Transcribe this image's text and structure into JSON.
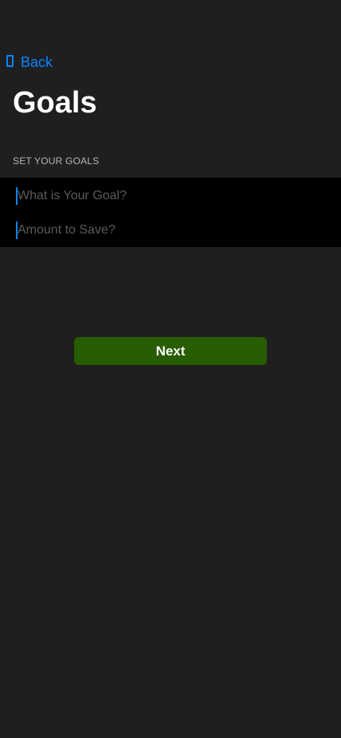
{
  "nav": {
    "back_label": "Back",
    "back_icon": "back-icon"
  },
  "header": {
    "title": "Goals"
  },
  "form": {
    "section_title": "SET YOUR GOALS",
    "goal_field": {
      "value": "",
      "placeholder": "What is Your Goal?"
    },
    "amount_field": {
      "value": "",
      "placeholder": "Amount to Save?"
    }
  },
  "actions": {
    "next_label": "Next"
  },
  "colors": {
    "background": "#1f1f1f",
    "accent": "#0a84ff",
    "field_background": "#000000",
    "button": "#285c00"
  }
}
